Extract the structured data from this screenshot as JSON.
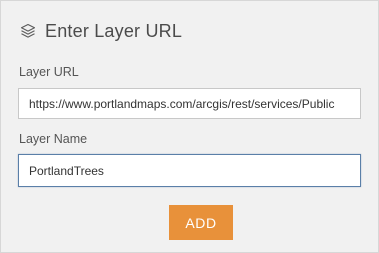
{
  "header": {
    "title": "Enter Layer URL",
    "icon": "layers-icon"
  },
  "form": {
    "url_label": "Layer URL",
    "url_value": "https://www.portlandmaps.com/arcgis/rest/services/Public",
    "name_label": "Layer Name",
    "name_value": "PortlandTrees",
    "add_label": "ADD"
  },
  "colors": {
    "panel_background": "#f1f1f1",
    "add_button": "#e8913a",
    "focus_border": "#5a7fa8"
  }
}
